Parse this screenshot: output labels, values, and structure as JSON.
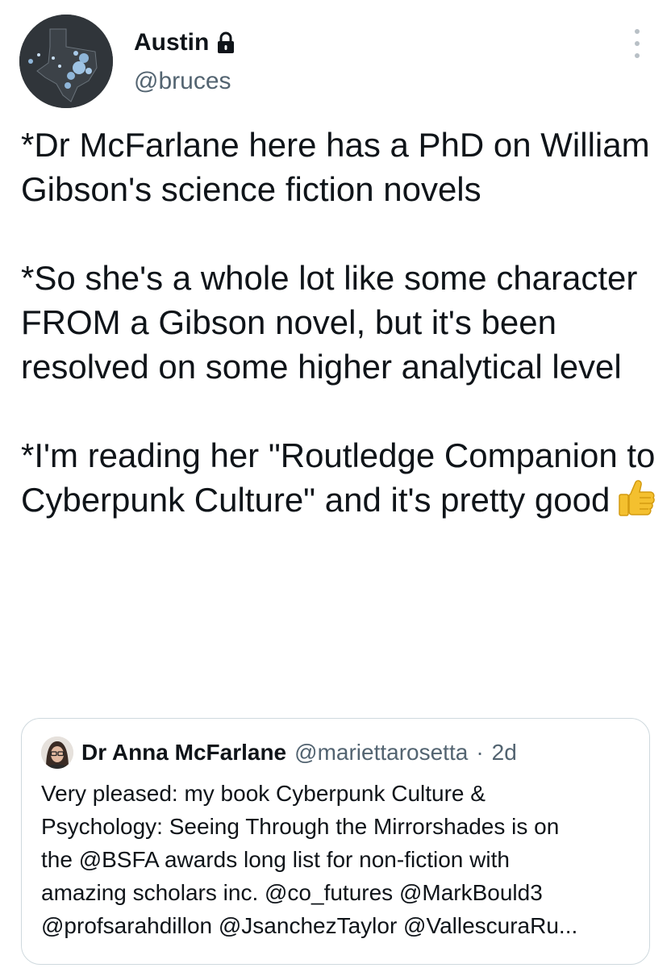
{
  "author": {
    "display_name": "Austin",
    "handle": "@bruces",
    "avatar_icon": "texas-map-avatar",
    "lock_icon": "lock-icon"
  },
  "tweet": {
    "paragraphs": [
      "*Dr McFarlane here has a PhD on William Gibson's science fiction novels",
      "*So she's a whole lot like some character FROM a Gibson novel, but it's been resolved on some higher analytical level",
      "*I'm reading her \"Routledge Companion to Cyberpunk Culture\" and it's pretty good"
    ],
    "emoji": "thumbs-up-emoji"
  },
  "quote_tweet": {
    "display_name": "Dr Anna McFarlane",
    "handle": "@mariettarosetta",
    "separator": "·",
    "time": "2d",
    "lines": [
      "Very pleased: my book Cyberpunk Culture &",
      "Psychology: Seeing Through the Mirrorshades is on",
      "the @BSFA awards long list for non-fiction with",
      "amazing scholars inc. @co_futures @MarkBould3",
      "@profsarahdillon @JsanchezTaylor @VallescuraRu..."
    ]
  },
  "colors": {
    "text": "#0f1419",
    "secondary": "#536471",
    "border": "#cfd9de"
  }
}
